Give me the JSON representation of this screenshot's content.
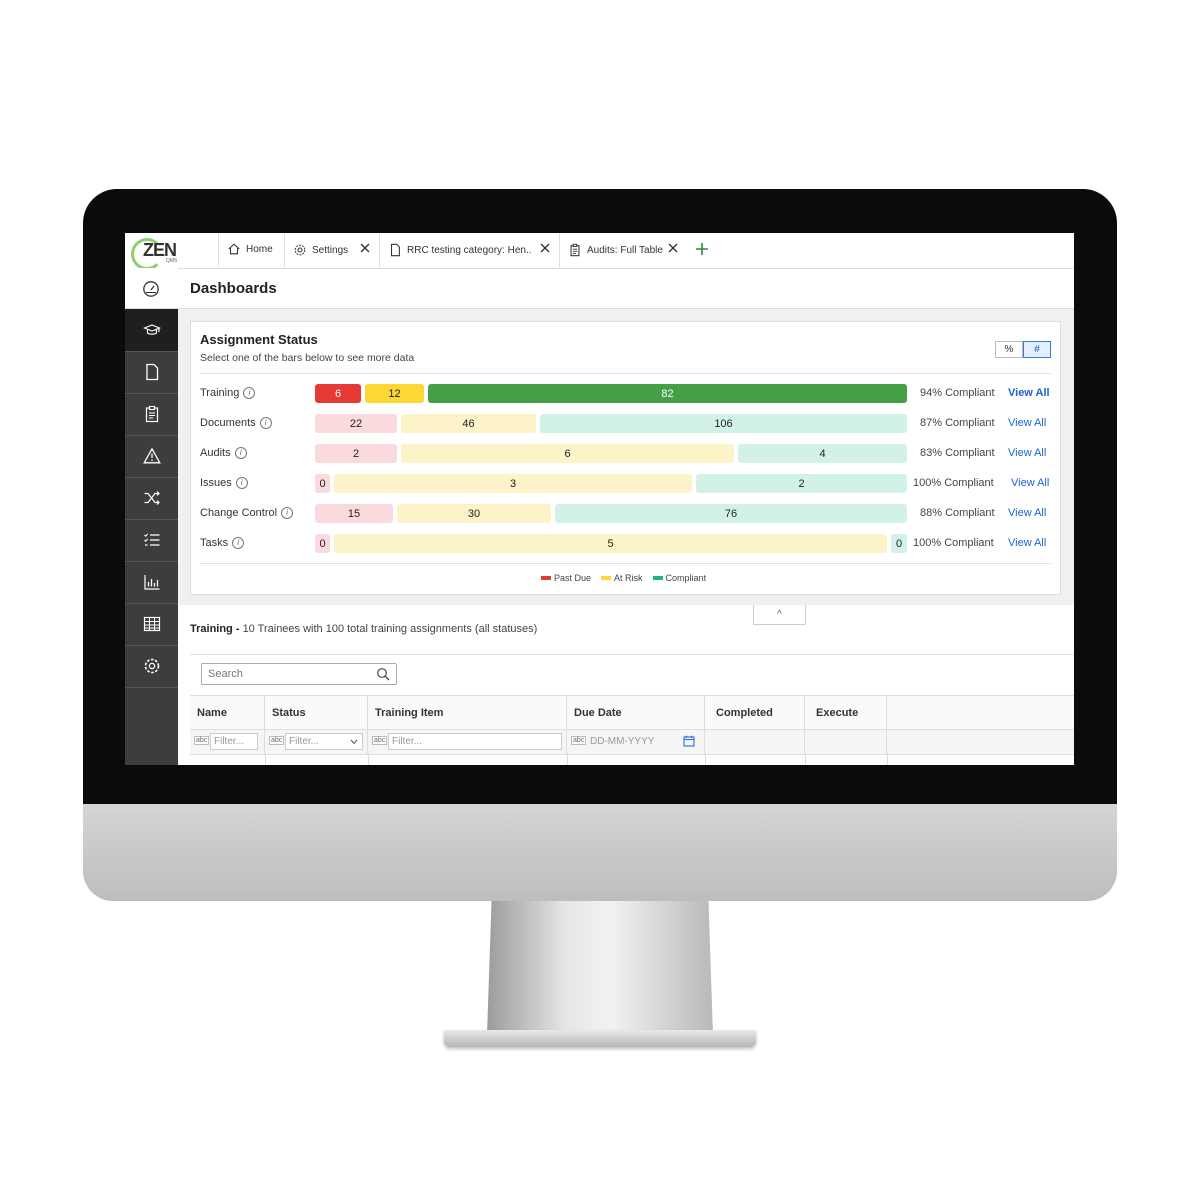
{
  "tabs": [
    {
      "label": "Home",
      "icon": "home-icon",
      "closable": false
    },
    {
      "label": "Settings",
      "icon": "gear-icon",
      "closable": true
    },
    {
      "label": "RRC testing category: Hen...",
      "icon": "document-icon",
      "closable": true
    },
    {
      "label": "Audits: Full Table",
      "icon": "clipboard-icon",
      "closable": true
    }
  ],
  "logo": {
    "text": "ZEN",
    "sub": "QMS"
  },
  "sidebar": {
    "items": [
      "dashboard-icon",
      "training-icon",
      "document-icon",
      "audit-icon",
      "issue-icon",
      "change-control-icon",
      "tasks-icon",
      "reports-icon",
      "table-icon",
      "settings-icon"
    ],
    "active": "training-icon"
  },
  "page": {
    "title": "Dashboards"
  },
  "assignment": {
    "title": "Assignment Status",
    "subtitle": "Select one of the bars below to see more data",
    "toggle": [
      "%",
      "#"
    ],
    "toggle_selected": "#",
    "rows": [
      {
        "label": "Training",
        "past_due": "6",
        "at_risk": "12",
        "compliant": "82",
        "compliance": "94% Compliant",
        "view_all": "View All"
      },
      {
        "label": "Documents",
        "past_due": "22",
        "at_risk": "46",
        "compliant": "106",
        "compliance": "87% Compliant",
        "view_all": "View All"
      },
      {
        "label": "Audits",
        "past_due": "2",
        "at_risk": "6",
        "compliant": "4",
        "compliance": "83% Compliant",
        "view_all": "View All"
      },
      {
        "label": "Issues",
        "past_due": "0",
        "at_risk": "3",
        "compliant": "2",
        "compliance": "100% Compliant",
        "view_all": "View All"
      },
      {
        "label": "Change Control",
        "past_due": "15",
        "at_risk": "30",
        "compliant": "76",
        "compliance": "88% Compliant",
        "view_all": "View All"
      },
      {
        "label": "Tasks",
        "past_due": "0",
        "at_risk": "5",
        "compliant": "0",
        "compliance": "100% Compliant",
        "view_all": "View All"
      }
    ],
    "legend": {
      "past_due": "Past Due",
      "at_risk": "At Risk",
      "compliant": "Compliant"
    },
    "colors": {
      "past_due_strong": "#e53935",
      "at_risk_strong": "#fdd835",
      "compliant_strong": "#43a047",
      "past_due_light": "#fadadd",
      "at_risk_light": "#fdf3c8",
      "compliant_light": "#d3f2e7"
    }
  },
  "collapse": {
    "symbol": "^"
  },
  "training": {
    "title": "Training -",
    "summary": "10 Trainees with 100 total training assignments (all statuses)"
  },
  "search": {
    "placeholder": "Search"
  },
  "table": {
    "columns": [
      "Name",
      "Status",
      "Training Item",
      "Due Date",
      "Completed",
      "Execute"
    ],
    "filter_placeholder": "Filter...",
    "date_placeholder": "DD-MM-YYYY",
    "filter_tag": "abc"
  }
}
